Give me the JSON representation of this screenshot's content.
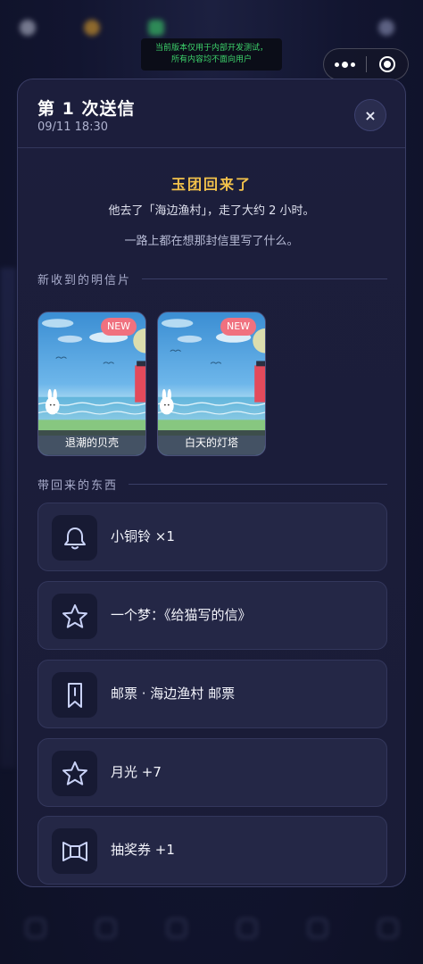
{
  "dev_notice": {
    "line1": "当前版本仅用于内部开发测试，",
    "line2": "所有内容均不面向用户"
  },
  "background_status": {
    "items": [
      {
        "icon": "moon-icon",
        "color": "#b8bccf"
      },
      {
        "icon": "coin-icon",
        "color": "#e0a12a"
      },
      {
        "icon": "gem-icon",
        "color": "#3dd36b"
      }
    ]
  },
  "background_nav": [
    {
      "icon": "home-icon"
    },
    {
      "icon": "map-icon"
    },
    {
      "icon": "bag-icon"
    },
    {
      "icon": "mail-icon"
    },
    {
      "icon": "shop-icon"
    },
    {
      "icon": "settings-icon"
    }
  ],
  "modal": {
    "title": "第 1 次送信",
    "time": "09/11 18:30",
    "close_icon": "×",
    "return_title": "玉团回来了",
    "return_line1": "他去了「海边渔村」，走了大约 2 小时。",
    "return_line2": "一路上都在想那封信里写了什么。",
    "postcards_section": "新收到的明信片",
    "postcards": [
      {
        "label": "退潮的贝壳",
        "badge": "NEW"
      },
      {
        "label": "白天的灯塔",
        "badge": "NEW"
      }
    ],
    "items_section": "带回来的东西",
    "items": [
      {
        "icon": "bell-icon",
        "label": "小铜铃 ×1"
      },
      {
        "icon": "star-icon",
        "label": "一个梦：《给猫写的信》"
      },
      {
        "icon": "bookmark-icon",
        "label": "邮票 · 海边渔村 邮票"
      },
      {
        "icon": "star-icon",
        "label": "月光 +7"
      },
      {
        "icon": "ticket-icon",
        "label": "抽奖券 +1"
      }
    ]
  },
  "colors": {
    "accent_gold": "#f3c24b",
    "badge_pink": "#f0717f",
    "icon_stroke": "#c9d2f7"
  }
}
